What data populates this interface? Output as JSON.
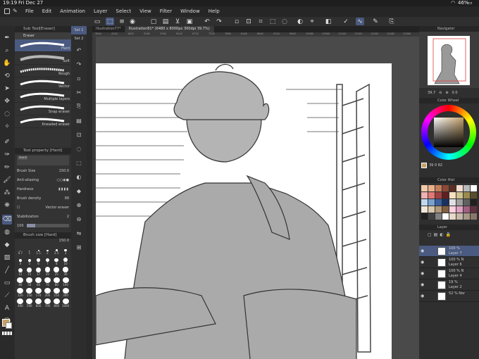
{
  "status": {
    "time": "19:19",
    "date": "Fri Dec 27",
    "battery": "46%"
  },
  "menu": [
    "File",
    "Edit",
    "Animation",
    "Layer",
    "Select",
    "View",
    "Filter",
    "Window",
    "Help"
  ],
  "sub_tool": {
    "title": "Sub Tool[Eraser]",
    "group": "Eraser",
    "brushes": [
      "Hard",
      "Soft",
      "Rough",
      "Vector",
      "Multiple layers",
      "Snap eraser",
      "Kneaded eraser"
    ]
  },
  "tool_property": {
    "title": "Tool property [Hard]",
    "tool_name": "Hard",
    "brush_size_label": "Brush Size",
    "brush_size": "150.0",
    "anti_aliasing_label": "Anti-aliasing",
    "hardness_label": "Hardness",
    "brush_density_label": "Brush density",
    "brush_density": "99",
    "vector_eraser_label": "Vector eraser",
    "stabilization_label": "Stabilization",
    "stabilization": "2",
    "stab_sub": "100"
  },
  "brush_size_panel": {
    "title": "Brush size [Hard]",
    "value": "150.0",
    "sizes": [
      "0.7",
      "1",
      "1.5",
      "2",
      "2.5",
      "3",
      "4",
      "5",
      "6",
      "7",
      "8",
      "10",
      "12",
      "15",
      "17",
      "20",
      "25",
      "30",
      "40",
      "50",
      "60",
      "70",
      "80",
      "100",
      "120",
      "150",
      "170",
      "200",
      "250",
      "300",
      "400",
      "500",
      "600",
      "700",
      "800",
      "1000"
    ]
  },
  "sets": [
    "Set 1",
    "Set 2"
  ],
  "tabs": [
    "Illustration77*",
    "Illustration81* (6480 x 8000px 300dpi 39.7%)"
  ],
  "navigator": {
    "title": "Navigator",
    "zoom": "39.7",
    "angle": "0.0"
  },
  "color_wheel": {
    "title": "Color Wheel",
    "values": "39  0  82"
  },
  "color_history": {
    "title": "Color Hist"
  },
  "palette": [
    "#f2c9a8",
    "#e8b08a",
    "#c27d5a",
    "#8a4a36",
    "#5a2f24",
    "#f5ddd0",
    "#b9b9b9",
    "#ffffff",
    "#f0b0b0",
    "#e07878",
    "#a04040",
    "#602020",
    "#f5e0c0",
    "#d0c090",
    "#9a8a50",
    "#5a4e2a",
    "#c0d8f0",
    "#7aa0d0",
    "#3a60a0",
    "#1a3060",
    "#e0e0e0",
    "#a0a0a0",
    "#606060",
    "#202020",
    "#f0e6d8",
    "#d8c8b0",
    "#b09878",
    "#806040",
    "#ffd0e0",
    "#e0a0c0",
    "#a06080",
    "#603040",
    "#202020",
    "#404040",
    "#808080",
    "#ffffff",
    "#e8d8c8",
    "#c8b8a8",
    "#a89888",
    "#887868"
  ],
  "layers_panel": {
    "title": "Layer",
    "layers": [
      {
        "pct": "100 %",
        "name": "Layer 7",
        "sel": true
      },
      {
        "pct": "100 %  N",
        "name": "Layer 6"
      },
      {
        "pct": "100 %  N",
        "name": "Layer 4"
      },
      {
        "pct": "19 %",
        "name": "Layer 2"
      },
      {
        "pct": "52 %  Nor",
        "name": ""
      }
    ]
  },
  "ruler_labels": [
    "3840",
    "4320",
    "4800",
    "5280",
    "5760",
    "6240",
    "6720",
    "7200",
    "7680",
    "8160",
    "8640",
    "9120",
    "9600",
    "10080",
    "10560",
    "11040",
    "11520",
    "12000",
    "12480",
    "12960"
  ],
  "colors": {
    "accent": "#4a5a80",
    "main_color": "#c4a16a"
  }
}
